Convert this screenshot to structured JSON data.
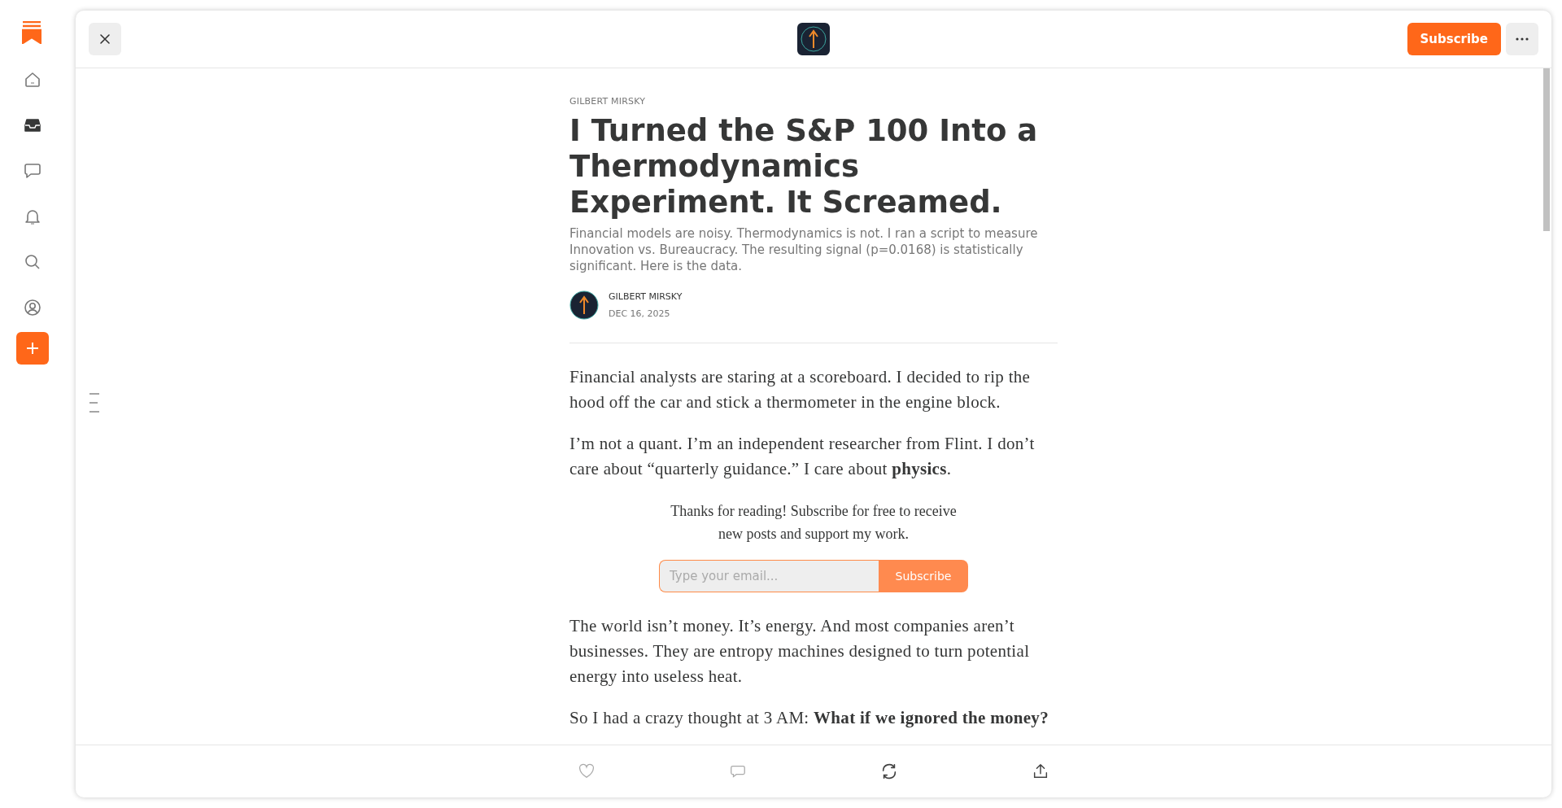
{
  "sidebar": {
    "items": [
      {
        "selected": false
      },
      {
        "selected": true
      },
      {
        "selected": false
      },
      {
        "selected": false
      },
      {
        "selected": false
      },
      {
        "selected": false
      }
    ]
  },
  "header": {
    "subscribe_button": "Subscribe"
  },
  "article": {
    "byline": "GILBERT MIRSKY",
    "title": "I Turned the S&P 100 Into a Thermodynamics Experiment. It Screamed.",
    "subtitle": "Financial models are noisy. Thermodynamics is not. I ran a script to measure Innovation vs. Bureaucracy. The resulting signal (p=0.0168) is statistically significant. Here is the data.",
    "author": {
      "name": "GILBERT MIRSKY",
      "date": "DEC 16, 2025"
    },
    "body": [
      {
        "kind": "paragraph",
        "text": "Financial analysts are staring at a scoreboard. I decided to rip the hood off the car and stick a thermometer in the engine block."
      },
      {
        "kind": "paragraph",
        "text": "I’m not a quant. I’m an independent researcher from Flint. I don’t care about “quarterly guidance.” I care about **physics**."
      },
      {
        "kind": "subscribe",
        "text": "Thanks for reading! Subscribe for free to receive new posts and support my work.",
        "placeholder": "Type your email...",
        "button": "Subscribe"
      },
      {
        "kind": "paragraph",
        "text": "The world isn’t money. It’s energy. And most companies aren’t businesses. They are entropy machines designed to turn potential energy into useless heat."
      },
      {
        "kind": "paragraph",
        "text": "So I had a crazy thought at 3 AM: **What if we ignored the money?**"
      }
    ]
  }
}
